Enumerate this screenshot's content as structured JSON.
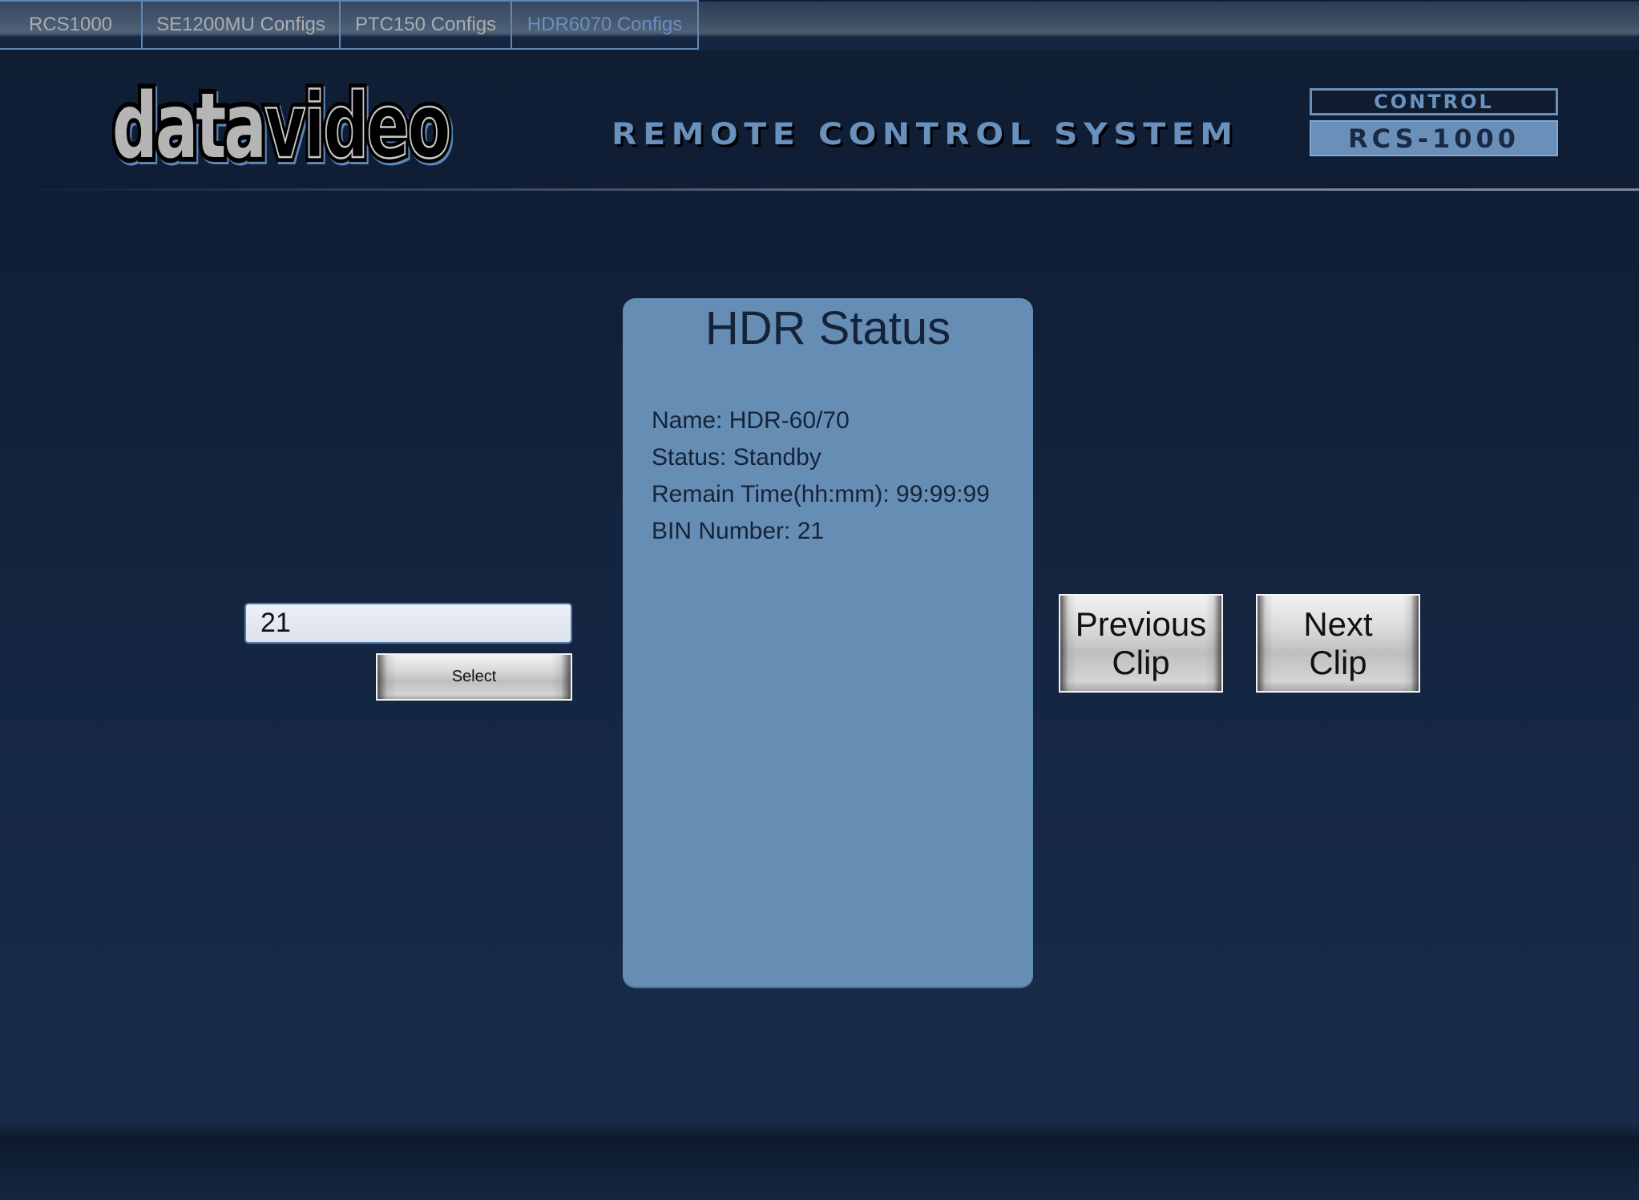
{
  "tabs": [
    {
      "label": "RCS1000",
      "active": false
    },
    {
      "label": "SE1200MU Configs",
      "active": false
    },
    {
      "label": "PTC150 Configs",
      "active": false
    },
    {
      "label": "HDR6070 Configs",
      "active": true
    }
  ],
  "header": {
    "logo_text_filled": "data",
    "logo_text_outline": "video",
    "system_title": "REMOTE CONTROL SYSTEM",
    "badge_top": "CONTROL",
    "badge_bottom": "RCS-1000"
  },
  "status_panel": {
    "title": "HDR Status",
    "lines": [
      "Name: HDR-60/70",
      "Status: Standby",
      "Remain Time(hh:mm): 99:99:99",
      "BIN Number: 21"
    ]
  },
  "bin_select": {
    "input_value": "21",
    "button_label": "Select"
  },
  "clip_nav": {
    "previous_label_line1": "Previous",
    "previous_label_line2": "Clip",
    "next_label_line1": "Next",
    "next_label_line2": "Clip"
  },
  "colors": {
    "panel": "#668db3",
    "accent": "#6a90bc",
    "background": "#142641"
  }
}
